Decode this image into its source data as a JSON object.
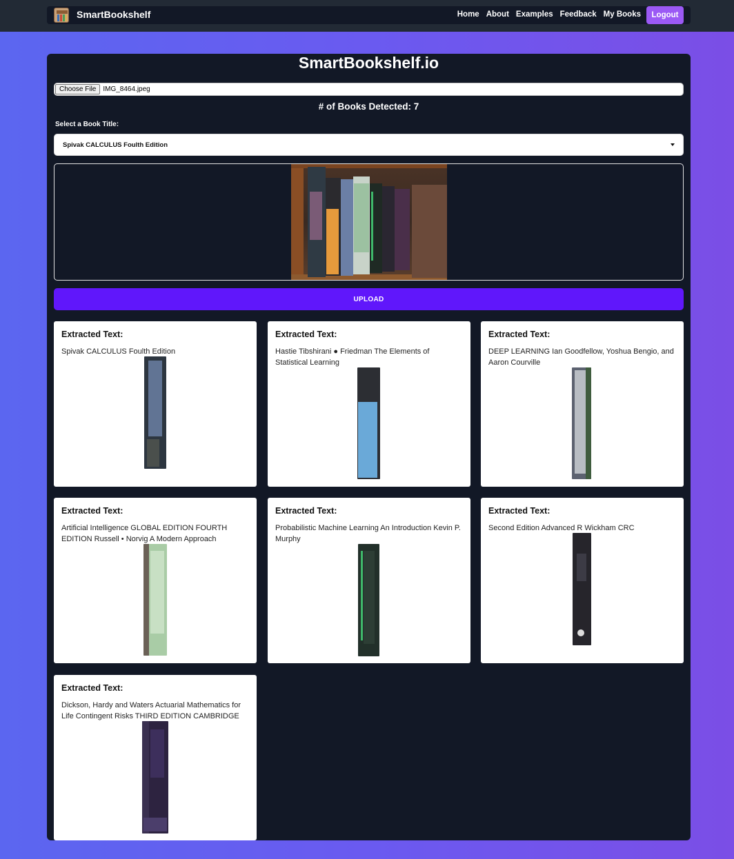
{
  "nav": {
    "brand": "SmartBookshelf",
    "links": [
      "Home",
      "About",
      "Examples",
      "Feedback",
      "My Books"
    ],
    "logout": "Logout"
  },
  "main": {
    "title": "SmartBookshelf.io",
    "file_button": "Choose File",
    "file_name": "IMG_8464.jpeg",
    "books_detected": "# of Books Detected: 7",
    "select_label": "Select a Book Title:",
    "selected_title": "Spivak CALCULUS Foulth Edition",
    "upload_label": "UPLOAD"
  },
  "cards": [
    {
      "heading": "Extracted Text:",
      "text": "Spivak CALCULUS Foulth Edition"
    },
    {
      "heading": "Extracted Text:",
      "text": "Hastie Tibshirani ● Friedman The Elements of Statistical Learning"
    },
    {
      "heading": "Extracted Text:",
      "text": "DEEP LEARNING Ian Goodfellow, Yoshua Bengio, and Aaron Courville"
    },
    {
      "heading": "Extracted Text:",
      "text": "Artificial Intelligence GLOBAL EDITION FOURTH EDITION Russell • Norvig A Modern Approach"
    },
    {
      "heading": "Extracted Text:",
      "text": "Probabilistic Machine Learning An Introduction Kevin P. Murphy"
    },
    {
      "heading": "Extracted Text:",
      "text": "Second Edition Advanced R Wickham CRC"
    },
    {
      "heading": "Extracted Text:",
      "text": "Dickson, Hardy and Waters Actuarial Mathematics for Life Contingent Risks THIRD EDITION CAMBRIDGE"
    }
  ],
  "colors": {
    "accent": "#6017fb",
    "logout": "#9b59f5",
    "panel": "#121826"
  }
}
